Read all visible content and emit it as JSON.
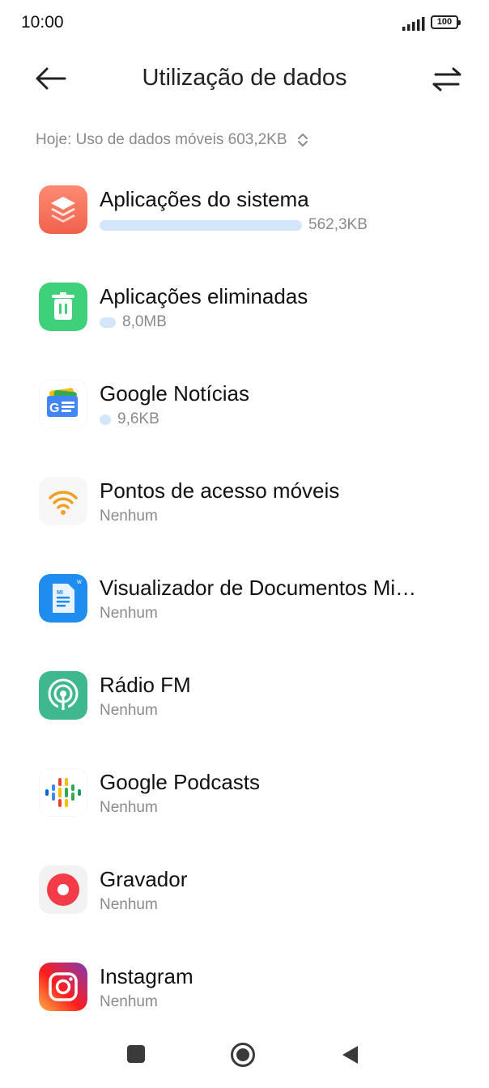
{
  "status_bar": {
    "time": "10:00",
    "battery": "100"
  },
  "header": {
    "title": "Utilização de dados"
  },
  "summary": {
    "text": "Hoje: Uso de dados móveis 603,2KB"
  },
  "apps": [
    {
      "name": "Aplicações do sistema",
      "usage": "562,3KB",
      "bar_fraction": 1.0,
      "icon": "system-apps-icon"
    },
    {
      "name": "Aplicações eliminadas",
      "usage": "8,0MB",
      "bar_fraction": 0.0,
      "icon": "trash-icon"
    },
    {
      "name": "Google Notícias",
      "usage": "9,6KB",
      "bar_fraction": 0.0,
      "icon": "google-news-icon"
    },
    {
      "name": "Pontos de acesso móveis",
      "usage": "Nenhum",
      "icon": "hotspot-icon"
    },
    {
      "name": "Visualizador de Documentos Mi…",
      "usage": "Nenhum",
      "icon": "mi-doc-viewer-icon"
    },
    {
      "name": "Rádio FM",
      "usage": "Nenhum",
      "icon": "fm-radio-icon"
    },
    {
      "name": "Google Podcasts",
      "usage": "Nenhum",
      "icon": "google-podcasts-icon"
    },
    {
      "name": "Gravador",
      "usage": "Nenhum",
      "icon": "recorder-icon"
    },
    {
      "name": "Instagram",
      "usage": "Nenhum",
      "icon": "instagram-icon"
    }
  ],
  "colors": {
    "usage_bar": "#d4e6fa",
    "secondary_text": "#8a8a8a"
  }
}
